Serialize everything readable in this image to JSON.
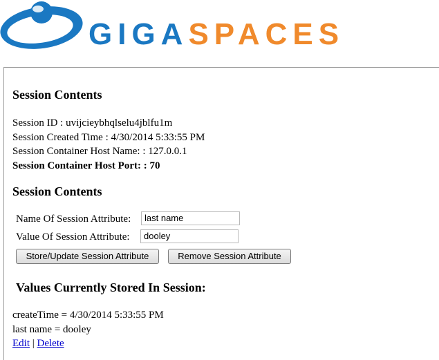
{
  "header": {
    "logo_part1": "GIGA",
    "logo_part2": "SPACES",
    "brand_blue": "#1a78c2",
    "brand_orange": "#f08a2c",
    "logo_icon": "gigaspaces-logo-icon"
  },
  "session": {
    "heading": "Session Contents",
    "id_line": "Session ID : uvijcieybhqlselu4jblfu1m",
    "created_line": "Session Created Time : 4/30/2014 5:33:55 PM",
    "host_name_line": "Session Container Host Name: : 127.0.0.1",
    "host_port_line": "Session Container Host Port: : 70"
  },
  "attribute_form": {
    "heading": "Session Contents",
    "name_label": "Name Of Session Attribute:",
    "name_value": "last name",
    "value_label": "Value Of Session Attribute:",
    "value_value": "dooley",
    "store_button": "Store/Update Session Attribute",
    "remove_button": "Remove Session Attribute"
  },
  "stored_values": {
    "heading": "Values Currently Stored In Session:",
    "items": [
      "createTime = 4/30/2014 5:33:55 PM",
      "last name = dooley"
    ],
    "edit_link": "Edit",
    "separator": "|",
    "delete_link": "Delete",
    "link_color": "#0000cc"
  }
}
